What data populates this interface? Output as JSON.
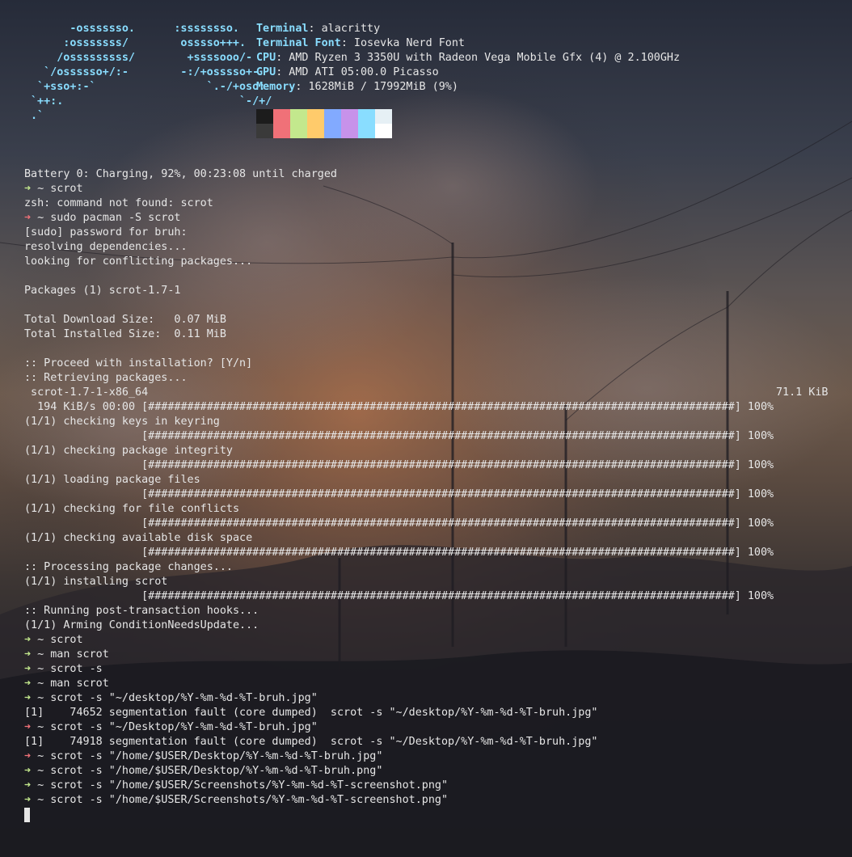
{
  "neofetch": {
    "logo": [
      "      -osssssso.      :ssssssso.",
      "     :osssssss/        osssso+++.",
      "    /osssssssss/        +ssssooo/-",
      "  `/ossssso+/:-        -:/+osssso+-",
      " `+sso+:-`                 `.-/+oso:",
      "`++:.                           `-/+/",
      ".`                                 `/"
    ],
    "info": [
      {
        "key": "Terminal",
        "value": ": alacritty"
      },
      {
        "key": "Terminal Font",
        "value": ": Iosevka Nerd Font"
      },
      {
        "key": "CPU",
        "value": ": AMD Ryzen 3 3350U with Radeon Vega Mobile Gfx (4) @ 2.100GHz"
      },
      {
        "key": "GPU",
        "value": ": AMD ATI 05:00.0 Picasso"
      },
      {
        "key": "Memory",
        "value": ": 1628MiB / 17992MiB (9%)"
      }
    ],
    "palette": [
      "#1c1c1c",
      "#f07178",
      "#c3e88d",
      "#ffcb6b",
      "#82aaff",
      "#c792ea",
      "#89ddff",
      "#e6f0f5",
      "#3a3a3a",
      "#f07178",
      "#c3e88d",
      "#ffcb6b",
      "#82aaff",
      "#c792ea",
      "#89ddff",
      "#ffffff"
    ]
  },
  "terminal": {
    "prompt_arrow": "➜",
    "prompt_dir": "~",
    "lines": [
      {
        "type": "text",
        "text": "Battery 0: Charging, 92%, 00:23:08 until charged"
      },
      {
        "type": "prompt",
        "status": "ok",
        "cmd": "scrot"
      },
      {
        "type": "text",
        "text": "zsh: command not found: scrot"
      },
      {
        "type": "prompt",
        "status": "err",
        "cmd": "sudo pacman -S scrot"
      },
      {
        "type": "text",
        "text": "[sudo] password for bruh:"
      },
      {
        "type": "text",
        "text": "resolving dependencies..."
      },
      {
        "type": "text",
        "text": "looking for conflicting packages..."
      },
      {
        "type": "text",
        "text": ""
      },
      {
        "type": "text",
        "text": "Packages (1) scrot-1.7-1"
      },
      {
        "type": "text",
        "text": ""
      },
      {
        "type": "text",
        "text": "Total Download Size:   0.07 MiB"
      },
      {
        "type": "text",
        "text": "Total Installed Size:  0.11 MiB"
      },
      {
        "type": "text",
        "text": ""
      },
      {
        "type": "text",
        "text": ":: Proceed with installation? [Y/n]"
      },
      {
        "type": "text",
        "text": ":: Retrieving packages..."
      },
      {
        "type": "text",
        "text": " scrot-1.7-1-x86_64",
        "right": "71.1 KiB"
      },
      {
        "type": "text",
        "text": "  194 KiB/s 00:00 [##########################################################################################] 100%"
      },
      {
        "type": "text",
        "text": "(1/1) checking keys in keyring"
      },
      {
        "type": "text",
        "text": "                  [##########################################################################################] 100%"
      },
      {
        "type": "text",
        "text": "(1/1) checking package integrity"
      },
      {
        "type": "text",
        "text": "                  [##########################################################################################] 100%"
      },
      {
        "type": "text",
        "text": "(1/1) loading package files"
      },
      {
        "type": "text",
        "text": "                  [##########################################################################################] 100%"
      },
      {
        "type": "text",
        "text": "(1/1) checking for file conflicts"
      },
      {
        "type": "text",
        "text": "                  [##########################################################################################] 100%"
      },
      {
        "type": "text",
        "text": "(1/1) checking available disk space"
      },
      {
        "type": "text",
        "text": "                  [##########################################################################################] 100%"
      },
      {
        "type": "text",
        "text": ":: Processing package changes..."
      },
      {
        "type": "text",
        "text": "(1/1) installing scrot"
      },
      {
        "type": "text",
        "text": "                  [##########################################################################################] 100%"
      },
      {
        "type": "text",
        "text": ":: Running post-transaction hooks..."
      },
      {
        "type": "text",
        "text": "(1/1) Arming ConditionNeedsUpdate..."
      },
      {
        "type": "prompt",
        "status": "ok",
        "cmd": "scrot"
      },
      {
        "type": "prompt",
        "status": "ok",
        "cmd": "man scrot"
      },
      {
        "type": "prompt",
        "status": "ok",
        "cmd": "scrot -s"
      },
      {
        "type": "prompt",
        "status": "ok",
        "cmd": "man scrot"
      },
      {
        "type": "prompt",
        "status": "ok",
        "cmd": "scrot -s \"~/desktop/%Y-%m-%d-%T-bruh.jpg\""
      },
      {
        "type": "text",
        "text": "[1]    74652 segmentation fault (core dumped)  scrot -s \"~/desktop/%Y-%m-%d-%T-bruh.jpg\""
      },
      {
        "type": "prompt",
        "status": "err",
        "cmd": "scrot -s \"~/Desktop/%Y-%m-%d-%T-bruh.jpg\""
      },
      {
        "type": "text",
        "text": "[1]    74918 segmentation fault (core dumped)  scrot -s \"~/Desktop/%Y-%m-%d-%T-bruh.jpg\""
      },
      {
        "type": "prompt",
        "status": "err",
        "cmd": "scrot -s \"/home/$USER/Desktop/%Y-%m-%d-%T-bruh.jpg\""
      },
      {
        "type": "prompt",
        "status": "ok",
        "cmd": "scrot -s \"/home/$USER/Desktop/%Y-%m-%d-%T-bruh.png\""
      },
      {
        "type": "prompt",
        "status": "ok",
        "cmd": "scrot -s \"/home/$USER/Screenshots/%Y-%m-%d-%T-screenshot.png\""
      },
      {
        "type": "prompt",
        "status": "ok",
        "cmd": "scrot -s \"/home/$USER/Screenshots/%Y-%m-%d-%T-screenshot.png\""
      }
    ]
  },
  "colors": {
    "foreground": "#e6e6e6",
    "cyan": "#89ddff",
    "green": "#c3e88d",
    "red": "#f07178"
  }
}
